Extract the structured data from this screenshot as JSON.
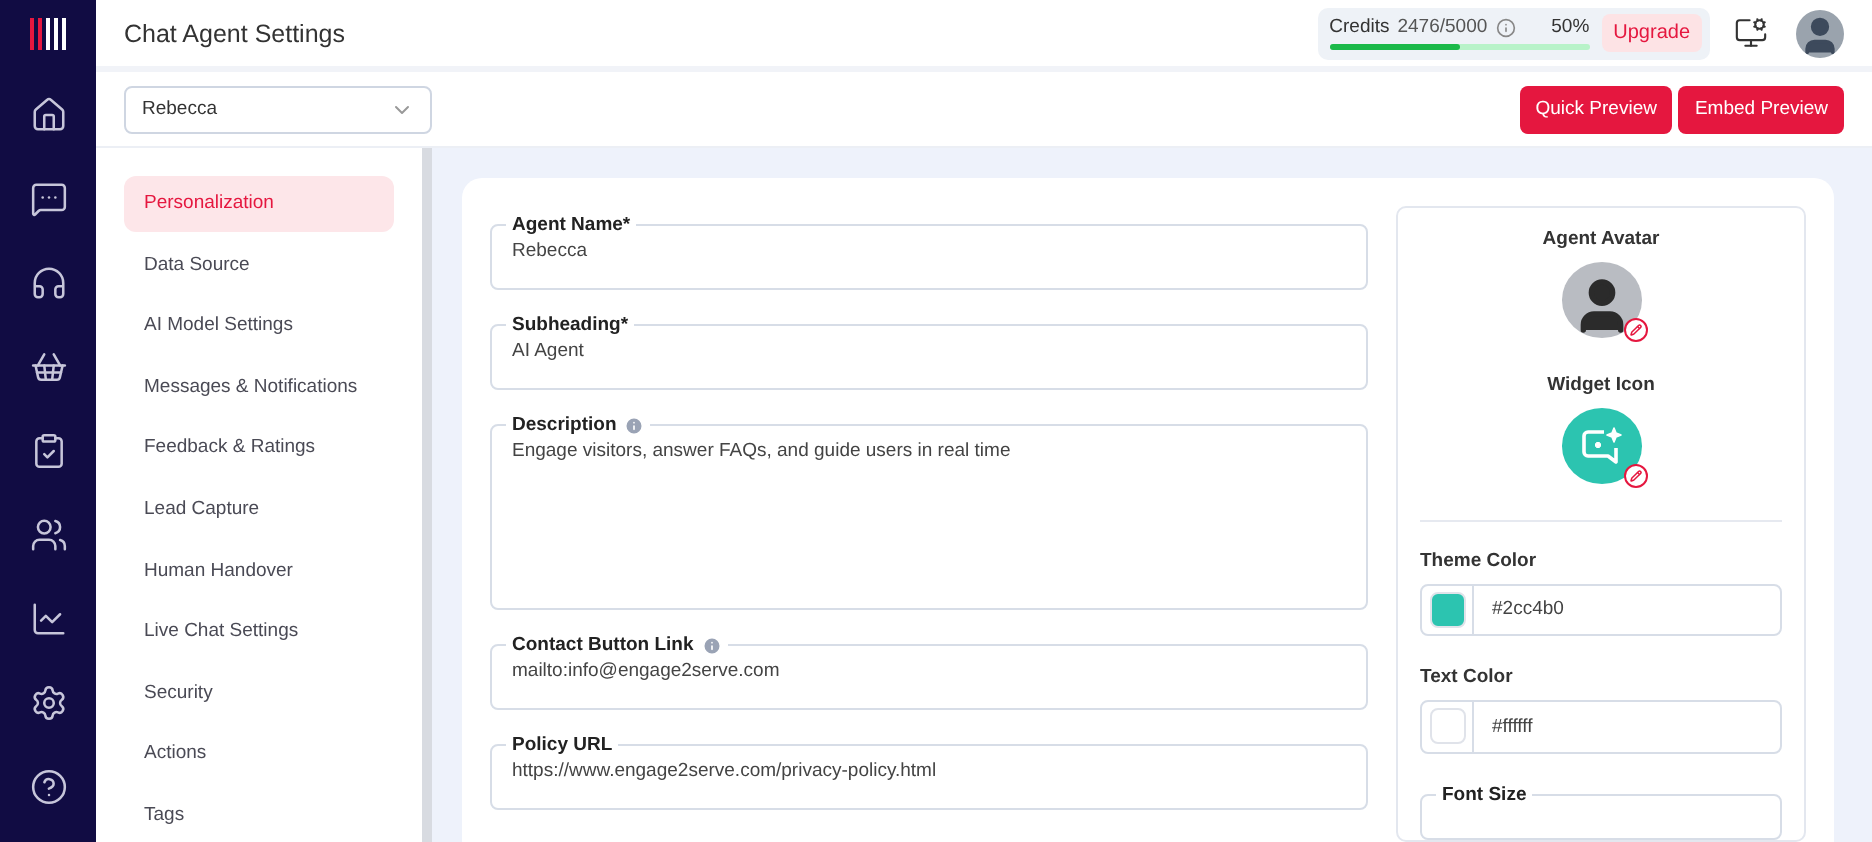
{
  "header": {
    "title": "Chat Agent Settings",
    "credits": {
      "label": "Credits",
      "value": "2476/5000",
      "percent": "50%",
      "level": 0.5
    },
    "upgrade": "Upgrade"
  },
  "agent_select": {
    "value": "Rebecca"
  },
  "actions": [
    "Quick Preview",
    "Embed Preview"
  ],
  "nav_icons": [
    {
      "kind": "home"
    },
    {
      "kind": "chat"
    },
    {
      "kind": "headset"
    },
    {
      "kind": "basket"
    },
    {
      "kind": "checklist"
    },
    {
      "kind": "users"
    },
    {
      "kind": "chart"
    },
    {
      "kind": "settings"
    },
    {
      "kind": "help"
    }
  ],
  "menu": [
    {
      "label": "Personalization",
      "selected": true
    },
    {
      "label": "Data Source",
      "selected": false
    },
    {
      "label": "AI Model Settings",
      "selected": false
    },
    {
      "label": "Messages & Notifications",
      "selected": false
    },
    {
      "label": "Feedback & Ratings",
      "selected": false
    },
    {
      "label": "Lead Capture",
      "selected": false
    },
    {
      "label": "Human Handover",
      "selected": false
    },
    {
      "label": "Live Chat Settings",
      "selected": false
    },
    {
      "label": "Security",
      "selected": false
    },
    {
      "label": "Actions",
      "selected": false
    },
    {
      "label": "Tags",
      "selected": false
    }
  ],
  "fields": [
    {
      "label": "Agent Name*",
      "value": "Rebecca",
      "info": false,
      "kind": "text"
    },
    {
      "label": "Subheading*",
      "value": "AI Agent",
      "info": false,
      "kind": "text"
    },
    {
      "label": "Description",
      "value": "Engage visitors, answer FAQs, and guide users in real time",
      "info": true,
      "kind": "textarea"
    },
    {
      "label": "Contact Button Link",
      "value": "mailto:info@engage2serve.com",
      "info": true,
      "kind": "text"
    },
    {
      "label": "Policy URL",
      "value": "https://www.engage2serve.com/privacy-policy.html",
      "info": false,
      "kind": "text"
    }
  ],
  "appearance": {
    "avatar_label": "Agent Avatar",
    "widget_label": "Widget Icon",
    "colors": [
      {
        "label": "Theme Color",
        "value": "#2cc4b0",
        "color": "#2cc4b0"
      },
      {
        "label": "Text Color",
        "value": "#ffffff",
        "color": "#ffffff"
      }
    ],
    "font_size": {
      "label": "Font Size"
    }
  }
}
